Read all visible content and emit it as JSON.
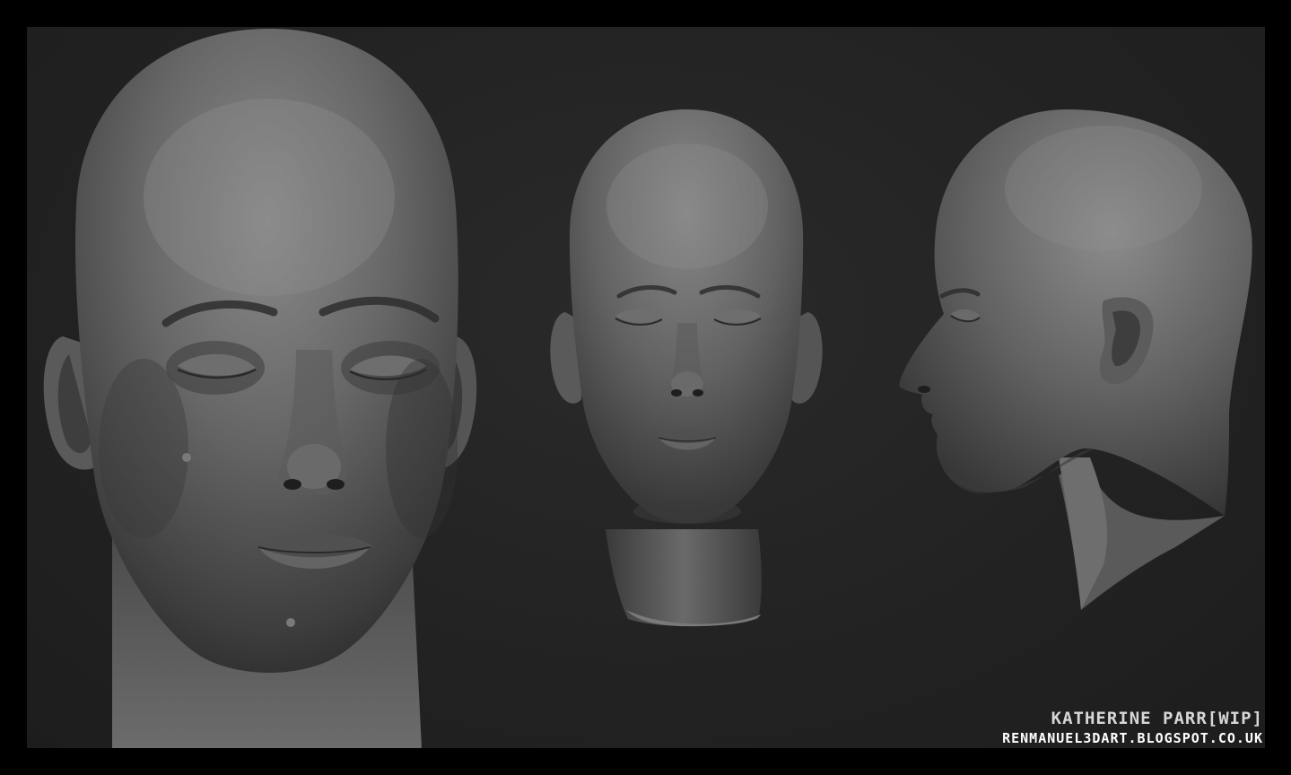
{
  "artwork": {
    "title": "KATHERINE PARR[WIP]",
    "url": "RENMANUEL3DART.BLOGSPOT.CO.UK"
  },
  "views": [
    {
      "name": "front-closeup"
    },
    {
      "name": "front-full"
    },
    {
      "name": "side-profile"
    }
  ],
  "colors": {
    "frame": "#000000",
    "background": "#252525",
    "skin_light": "#7f7f7f",
    "skin_mid": "#565656",
    "skin_dark": "#2e2e2e",
    "text_title": "#d7d7d7",
    "text_url": "#ffffff"
  }
}
